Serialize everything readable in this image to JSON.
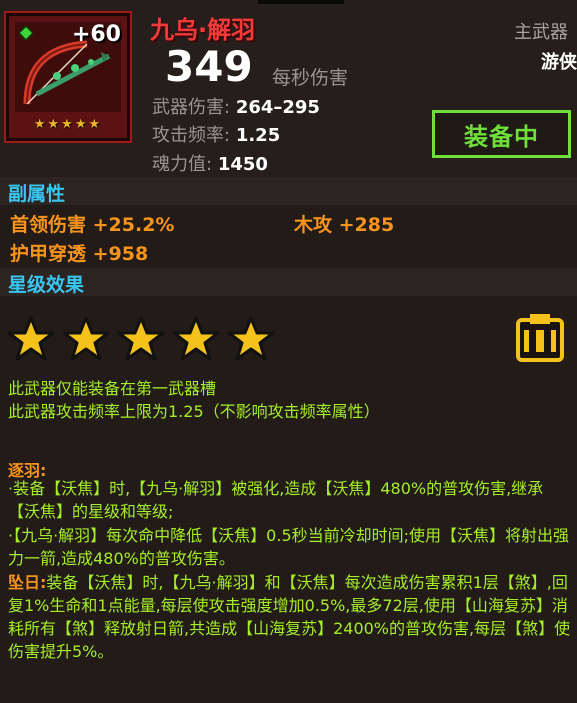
{
  "weapon": {
    "name": "九乌·解羽",
    "level_plus": "+60",
    "icon_stars": "★★★★★",
    "dps": "349",
    "dps_label": "每秒伤害",
    "stats": [
      {
        "key": "武器伤害:",
        "value": "264–295"
      },
      {
        "key": "攻击频率:",
        "value": "1.25"
      },
      {
        "key": "魂力值:",
        "value": "1450"
      }
    ],
    "slot_label": "主武器",
    "class_label": "游侠",
    "equip_button": "装备中"
  },
  "sub_attributes": {
    "title": "副属性",
    "items": [
      "首领伤害 +25.2%",
      "木攻 +285",
      "护甲穿透 +958"
    ]
  },
  "star_effect": {
    "title": "星级效果",
    "star_count": 5,
    "lines": [
      "此武器仅能装备在第一武器槽",
      "此武器攻击频率上限为1.25（不影响攻击频率属性）"
    ],
    "skill1_title": "逐羽:",
    "skill1_p1": "·装备【沃焦】时,【九乌·解羽】被强化,造成【沃焦】480%的普攻伤害,继承【沃焦】的星级和等级;",
    "skill1_p2": "·【九乌·解羽】每次命中降低【沃焦】0.5秒当前冷却时间;使用【沃焦】将射出强力一箭,造成480%的普攻伤害。",
    "skill2_title": "坠日:",
    "skill2_text": "装备【沃焦】时,【九乌·解羽】和【沃焦】每次造成伤害累积1层【煞】,回复1%生命和1点能量,每层使攻击强度增加0.5%,最多72层,使用【山海复苏】消耗所有【煞】释放射日箭,共造成【山海复苏】2400%的普攻伤害,每层【煞】使伤害提升5%。"
  },
  "colors": {
    "background": "#221b17",
    "name_red": "#f23a3a",
    "section_blue": "#39c6f0",
    "attr_orange": "#f7941d",
    "desc_green": "#a6ee2a",
    "equip_green": "#6fe03a",
    "star_yellow": "#f5c21c"
  }
}
